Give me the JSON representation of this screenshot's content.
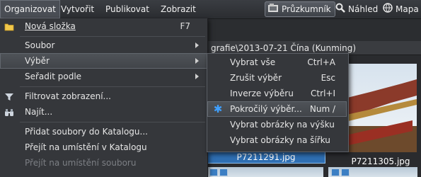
{
  "menubar": {
    "items": [
      {
        "label": "Organizovat",
        "key": "O"
      },
      {
        "label": "Vytvořit",
        "key": "V"
      },
      {
        "label": "Publikovat",
        "key": "P"
      },
      {
        "label": "Zobrazit",
        "key": "b"
      }
    ],
    "views": [
      {
        "label": "Průzkumník",
        "icon": "explorer-icon"
      },
      {
        "label": "Náhled",
        "icon": "magnifier-icon"
      },
      {
        "label": "Mapa",
        "icon": "globe-icon"
      }
    ]
  },
  "background": {
    "path": "grafie\\2013-07-21 Čína (Kunming)",
    "thumbnails": [
      {
        "name": "P7211291.jpg",
        "selected": true
      },
      {
        "name": "P7211305.jpg",
        "selected": false
      }
    ]
  },
  "organize_menu": {
    "items": [
      {
        "label": "Nová složka",
        "shortcut": "F7",
        "icon": "folder-icon",
        "has_submenu": false,
        "disabled": false
      },
      {
        "label": "Soubor",
        "shortcut": "",
        "icon": "",
        "has_submenu": true,
        "disabled": false
      },
      {
        "label": "Výběr",
        "shortcut": "",
        "icon": "",
        "has_submenu": true,
        "disabled": false,
        "highlighted": true
      },
      {
        "label": "Seřadit podle",
        "shortcut": "",
        "icon": "",
        "has_submenu": true,
        "disabled": false
      },
      {
        "label": "Filtrovat zobrazení...",
        "shortcut": "",
        "icon": "filter-icon",
        "has_submenu": false,
        "disabled": false
      },
      {
        "label": "Najít...",
        "shortcut": "",
        "icon": "binoculars-icon",
        "has_submenu": false,
        "disabled": false
      },
      {
        "label": "Přidat soubory do Katalogu...",
        "shortcut": "",
        "icon": "",
        "has_submenu": false,
        "disabled": false
      },
      {
        "label": "Přejít na umístění v Katalogu",
        "shortcut": "",
        "icon": "",
        "has_submenu": false,
        "disabled": false
      },
      {
        "label": "Přejít na umístění souboru",
        "shortcut": "",
        "icon": "",
        "has_submenu": false,
        "disabled": true
      }
    ]
  },
  "selection_submenu": {
    "items": [
      {
        "label": "Vybrat vše",
        "shortcut": "Ctrl+A"
      },
      {
        "label": "Zrušit výběr",
        "shortcut": "Esc"
      },
      {
        "label": "Inverze výběru",
        "shortcut": "Ctrl+I"
      },
      {
        "label": "Pokročilý výběr...",
        "shortcut": "Num /",
        "icon": "asterisk-icon",
        "highlighted": true
      },
      {
        "label": "Vybrat obrázky na výšku",
        "shortcut": ""
      },
      {
        "label": "Vybrat obrázky na šířku",
        "shortcut": ""
      }
    ]
  },
  "colors": {
    "menu_bg": "#35373b",
    "highlight": "#4a4e55",
    "selection_blue": "#2f6fb3",
    "asterisk": "#3fa0ff"
  }
}
